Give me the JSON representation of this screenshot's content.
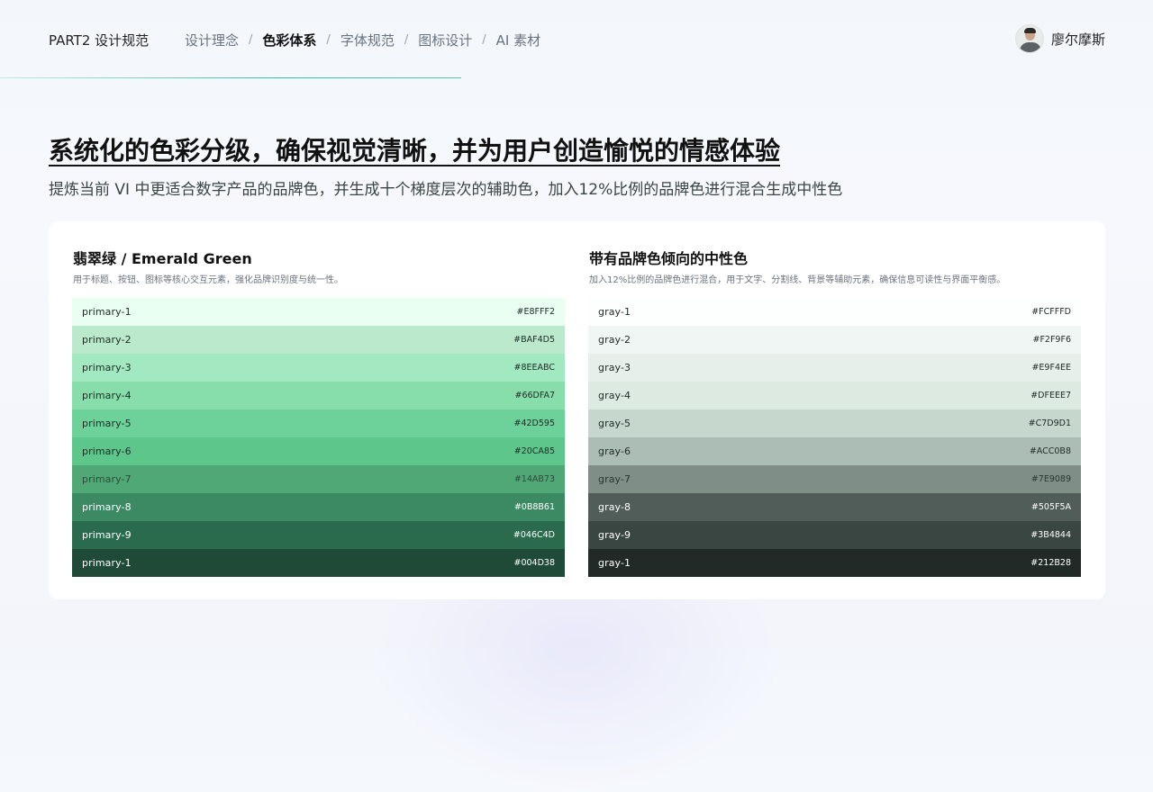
{
  "header": {
    "part": "PART2 设计规范",
    "nav": [
      {
        "label": "设计理念",
        "active": false
      },
      {
        "label": "色彩体系",
        "active": true
      },
      {
        "label": "字体规范",
        "active": false
      },
      {
        "label": "图标设计",
        "active": false
      },
      {
        "label": "AI 素材",
        "active": false
      }
    ],
    "separator": "/",
    "user_name": "廖尔摩斯"
  },
  "title": "系统化的色彩分级，确保视觉清晰，并为用户创造愉悦的情感体验",
  "subtitle": "提炼当前 VI 中更适合数字产品的品牌色，并生成十个梯度层次的辅助色，加入12%比例的品牌色进行混合生成中性色",
  "palettes": {
    "primary": {
      "title": "翡翠绿 / Emerald Green",
      "description": "用于标题、按钮、图标等核心交互元素，强化品牌识别度与统一性。",
      "swatches": [
        {
          "name": "primary-1",
          "hex": "#E8FFF2",
          "color": "#E8FFF2",
          "text_color": "#1f2a27"
        },
        {
          "name": "primary-2",
          "hex": "#BAF4D5",
          "color": "#BAE9CC",
          "text_color": "#1f2a27"
        },
        {
          "name": "primary-3",
          "hex": "#8EEABC",
          "color": "#A2E8C0",
          "text_color": "#1f2a27"
        },
        {
          "name": "primary-4",
          "hex": "#66DFA7",
          "color": "#87DEAB",
          "text_color": "#1f2a27"
        },
        {
          "name": "primary-5",
          "hex": "#42D595",
          "color": "#6DD29A",
          "text_color": "#1f2a27"
        },
        {
          "name": "primary-6",
          "hex": "#20CA85",
          "color": "#5DC68A",
          "text_color": "#1f2a27"
        },
        {
          "name": "primary-7",
          "hex": "#14AB73",
          "color": "#4FA876",
          "text_color": "#2f4a3c"
        },
        {
          "name": "primary-8",
          "hex": "#0B8B61",
          "color": "#3B8A63",
          "text_color": "#ffffff"
        },
        {
          "name": "primary-9",
          "hex": "#046C4D",
          "color": "#2A6B4E",
          "text_color": "#ffffff"
        },
        {
          "name": "primary-1",
          "hex": "#004D38",
          "color": "#1E4A37",
          "text_color": "#ffffff"
        }
      ]
    },
    "gray": {
      "title": "带有品牌色倾向的中性色",
      "description": "加入12%比例的品牌色进行混合，用于文字、分割线、背景等辅助元素，确保信息可读性与界面平衡感。",
      "swatches": [
        {
          "name": "gray-1",
          "hex": "#FCFFFD",
          "color": "#FCFFFD",
          "text_color": "#1f2a27"
        },
        {
          "name": "gray-2",
          "hex": "#F2F9F6",
          "color": "#F0F6F3",
          "text_color": "#1f2a27"
        },
        {
          "name": "gray-3",
          "hex": "#E9F4EE",
          "color": "#E6F0EA",
          "text_color": "#1f2a27"
        },
        {
          "name": "gray-4",
          "hex": "#DFEEE7",
          "color": "#DCEAE2",
          "text_color": "#1f2a27"
        },
        {
          "name": "gray-5",
          "hex": "#C7D9D1",
          "color": "#C6D7CE",
          "text_color": "#1f2a27"
        },
        {
          "name": "gray-6",
          "hex": "#ACC0B8",
          "color": "#ABBDB4",
          "text_color": "#1f2a27"
        },
        {
          "name": "gray-7",
          "hex": "#7E9089",
          "color": "#7F8F88",
          "text_color": "#2a3531"
        },
        {
          "name": "gray-8",
          "hex": "#505F5A",
          "color": "#505D59",
          "text_color": "#ffffff"
        },
        {
          "name": "gray-9",
          "hex": "#3B4844",
          "color": "#3A4642",
          "text_color": "#ffffff"
        },
        {
          "name": "gray-1",
          "hex": "#212B28",
          "color": "#212A27",
          "text_color": "#ffffff"
        }
      ]
    }
  }
}
